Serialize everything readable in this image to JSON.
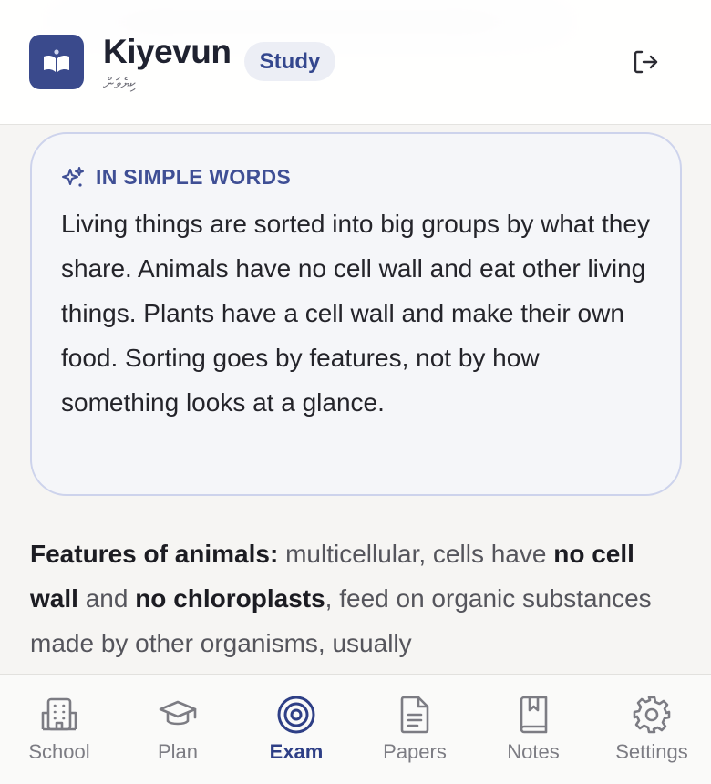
{
  "header": {
    "app_name": "Kiyevun",
    "app_subtitle": "ކިޔެވުން",
    "mode_badge": "Study",
    "logo_icon": "open-book-icon",
    "logout_icon": "logout-icon"
  },
  "simple_words": {
    "label": "IN SIMPLE WORDS",
    "icon": "sparkles-icon",
    "text": "Living things are sorted into big groups by what they share. Animals have no cell wall and eat other living things. Plants have a cell wall and make their own food. Sorting goes by features, not by how something looks at a glance."
  },
  "features": {
    "heading": "Features of animals:",
    "part1": " multicellular, cells have ",
    "bold1": "no cell wall",
    "part2": " and ",
    "bold2": "no chloroplasts",
    "part3": ", feed on organic substances made by other organisms, usually"
  },
  "nav": {
    "items": [
      {
        "label": "School",
        "icon": "school-building-icon",
        "active": false
      },
      {
        "label": "Plan",
        "icon": "graduation-cap-icon",
        "active": false
      },
      {
        "label": "Exam",
        "icon": "target-icon",
        "active": true
      },
      {
        "label": "Papers",
        "icon": "document-icon",
        "active": false
      },
      {
        "label": "Notes",
        "icon": "bookmark-book-icon",
        "active": false
      },
      {
        "label": "Settings",
        "icon": "gear-icon",
        "active": false
      }
    ]
  },
  "colors": {
    "accent": "#34478e",
    "card_border": "#cdd3ec",
    "nav_inactive": "#7c7c83"
  }
}
